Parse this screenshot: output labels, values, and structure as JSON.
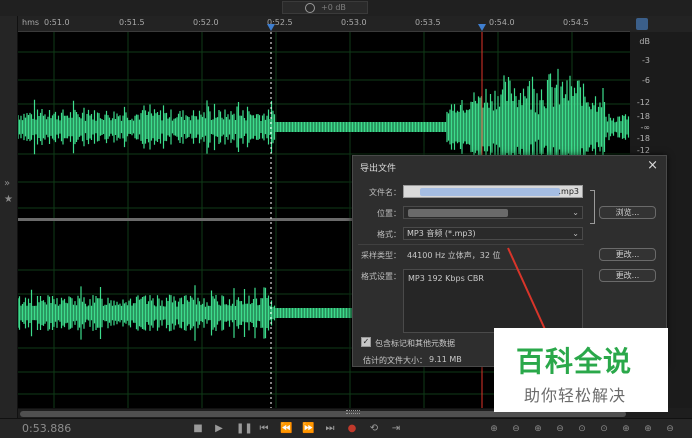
{
  "top_volume": {
    "value": "+0 dB"
  },
  "ruler": {
    "unit": "hms",
    "labels": [
      "0:51.0",
      "0:51.5",
      "0:52.0",
      "0:52.5",
      "0:53.0",
      "0:53.5",
      "0:54.0",
      "0:54.5"
    ]
  },
  "db_scale": [
    "dB",
    "-3",
    "-6",
    "-12",
    "-18",
    "-∞",
    "-18",
    "-12"
  ],
  "dialog": {
    "title": "导出文件",
    "close": "×",
    "filename_label": "文件名：",
    "filename_suffix": ".mp3",
    "location_label": "位置：",
    "format_label": "格式：",
    "format_value": "MP3 音频 (*.mp3)",
    "browse_button": "浏览...",
    "sample_type_label": "采样类型：",
    "sample_type_value": "44100 Hz 立体声，32 位",
    "change_button_1": "更改...",
    "format_settings_label": "格式设置：",
    "format_settings_value": "MP3 192 Kbps CBR",
    "change_button_2": "更改...",
    "include_markers_label": "包含标记和其他元数据",
    "include_markers_checked": true,
    "estimated_size_label": "估计的文件大小：",
    "estimated_size_value": "9.11 MB"
  },
  "transport": {
    "time": "0:53.886"
  },
  "watermark": {
    "line1": "百科全说",
    "line2": "助你轻松解决"
  },
  "colors": {
    "waveform": "#3ddc8c",
    "playhead": "#e0342a",
    "marker": "#3f7fd0",
    "watermark_green": "#2aa84a"
  }
}
